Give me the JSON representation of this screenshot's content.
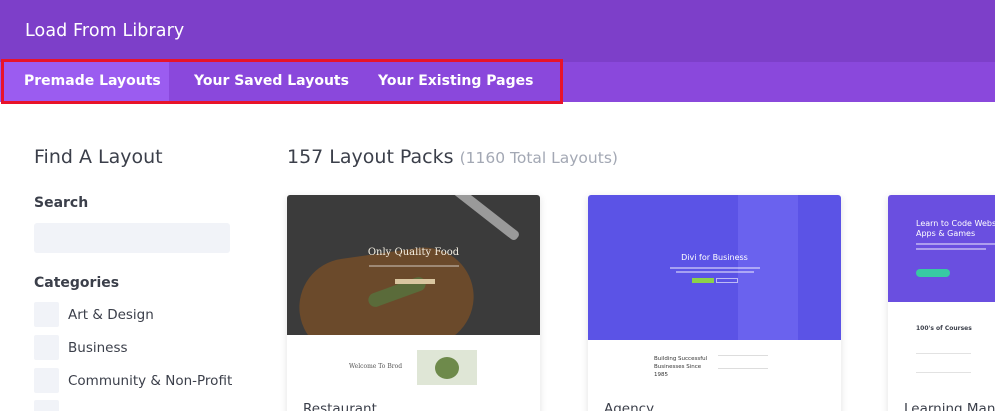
{
  "window": {
    "title": "Load From Library"
  },
  "tabs": [
    {
      "label": "Premade Layouts",
      "active": true
    },
    {
      "label": "Your Saved Layouts",
      "active": false
    },
    {
      "label": "Your Existing Pages",
      "active": false
    }
  ],
  "sidebar": {
    "title": "Find A Layout",
    "search_label": "Search",
    "search_value": "",
    "categories_label": "Categories",
    "categories": [
      "Art & Design",
      "Business",
      "Community & Non-Profit"
    ]
  },
  "main": {
    "heading": "157 Layout Packs",
    "subheading": "(1160 Total Layouts)",
    "cards": [
      {
        "name": "Restaurant",
        "thumb_headline": "Only Quality Food",
        "thumb_subtext": "Welcome To Brod"
      },
      {
        "name": "Agency",
        "thumb_headline": "Divi for Business",
        "thumb_subtext": "Building Successful Businesses Since 1985"
      },
      {
        "name": "Learning Mana",
        "thumb_headline": "Learn to Code Websi\nApps & Games",
        "thumb_subtext": "100's of Courses"
      }
    ]
  },
  "colors": {
    "header": "#7d3fc9",
    "tabs_bar": "#8a48dc",
    "active_tab": "#9b5cf0",
    "highlight": "#e8132a"
  }
}
